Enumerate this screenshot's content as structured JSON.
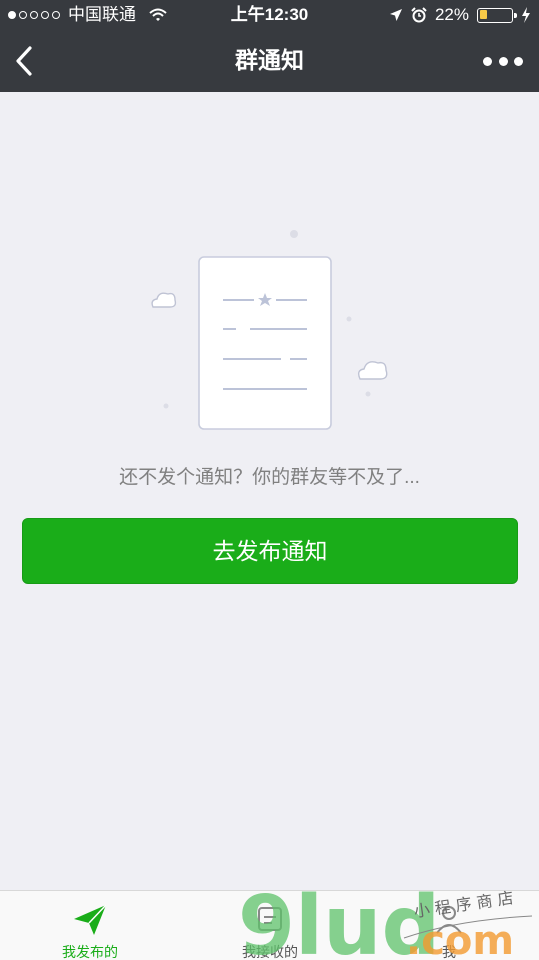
{
  "status_bar": {
    "carrier": "中国联通",
    "time": "上午12:30",
    "battery_percent": "22%",
    "battery_level": 0.22,
    "battery_color": "#f7c948",
    "signal_bars_filled": 1,
    "icons": [
      "wifi-icon",
      "location-arrow-icon",
      "alarm-clock-icon",
      "charging-bolt-icon"
    ]
  },
  "navbar": {
    "title": "群通知",
    "back_icon": "chevron-left-icon",
    "more_icon": "more-dots-icon",
    "background": "#373a3f"
  },
  "main": {
    "empty_message": "还不发个通知？你的群友等不及了...",
    "publish_button_label": "去发布通知",
    "accent_color": "#1aad19",
    "illustration_icon": "document-with-star-icon"
  },
  "tabbar": {
    "tabs": [
      {
        "label": "我发布的",
        "icon": "paper-plane-icon",
        "active": true
      },
      {
        "label": "我接收的",
        "icon": "inbox-icon",
        "active": false
      },
      {
        "label": "我",
        "icon": "person-icon",
        "active": false
      }
    ]
  },
  "watermark": {
    "logo_text": "9lud",
    "domain_text": ".com",
    "handwritten_text": "小程序商店"
  }
}
